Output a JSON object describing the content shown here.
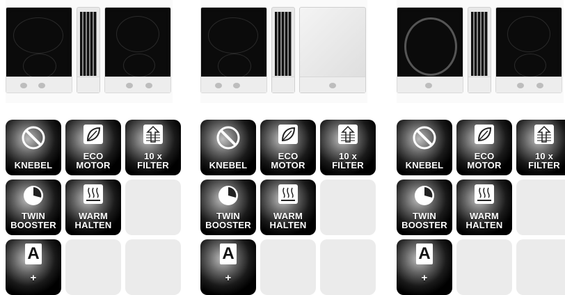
{
  "columns": [
    {
      "product": "cooktop-vent-cooktop",
      "tiles": [
        {
          "type": "feature",
          "icon": "knob-icon",
          "label": "KNEBEL"
        },
        {
          "type": "feature",
          "icon": "leaf-icon",
          "label": "ECO\nMOTOR"
        },
        {
          "type": "feature",
          "icon": "filter-icon",
          "label": "10 x\nFILTER"
        },
        {
          "type": "feature",
          "icon": "timer-icon",
          "label": "TWIN\nBOOSTER"
        },
        {
          "type": "feature",
          "icon": "heat-icon",
          "label": "WARM\nHALTEN"
        },
        {
          "type": "empty"
        },
        {
          "type": "feature",
          "icon": "energy-a-icon",
          "label": "+"
        },
        {
          "type": "empty"
        },
        {
          "type": "empty"
        }
      ]
    },
    {
      "product": "cooktop-vent-teppanyaki",
      "tiles": [
        {
          "type": "feature",
          "icon": "knob-icon",
          "label": "KNEBEL"
        },
        {
          "type": "feature",
          "icon": "leaf-icon",
          "label": "ECO\nMOTOR"
        },
        {
          "type": "feature",
          "icon": "filter-icon",
          "label": "10 x\nFILTER"
        },
        {
          "type": "feature",
          "icon": "timer-icon",
          "label": "TWIN\nBOOSTER"
        },
        {
          "type": "feature",
          "icon": "heat-icon",
          "label": "WARM\nHALTEN"
        },
        {
          "type": "empty"
        },
        {
          "type": "feature",
          "icon": "energy-a-icon",
          "label": "+"
        },
        {
          "type": "empty"
        },
        {
          "type": "empty"
        }
      ]
    },
    {
      "product": "wok-vent-cooktop",
      "tiles": [
        {
          "type": "feature",
          "icon": "knob-icon",
          "label": "KNEBEL"
        },
        {
          "type": "feature",
          "icon": "leaf-icon",
          "label": "ECO\nMOTOR"
        },
        {
          "type": "feature",
          "icon": "filter-icon",
          "label": "10 x\nFILTER"
        },
        {
          "type": "feature",
          "icon": "timer-icon",
          "label": "TWIN\nBOOSTER"
        },
        {
          "type": "feature",
          "icon": "heat-icon",
          "label": "WARM\nHALTEN"
        },
        {
          "type": "empty"
        },
        {
          "type": "feature",
          "icon": "energy-a-icon",
          "label": "+"
        },
        {
          "type": "empty"
        },
        {
          "type": "empty"
        }
      ]
    }
  ],
  "energy_letter": "A",
  "colors": {
    "tile_dark": "#000000",
    "tile_empty": "#ebebeb",
    "label": "#ffffff"
  }
}
